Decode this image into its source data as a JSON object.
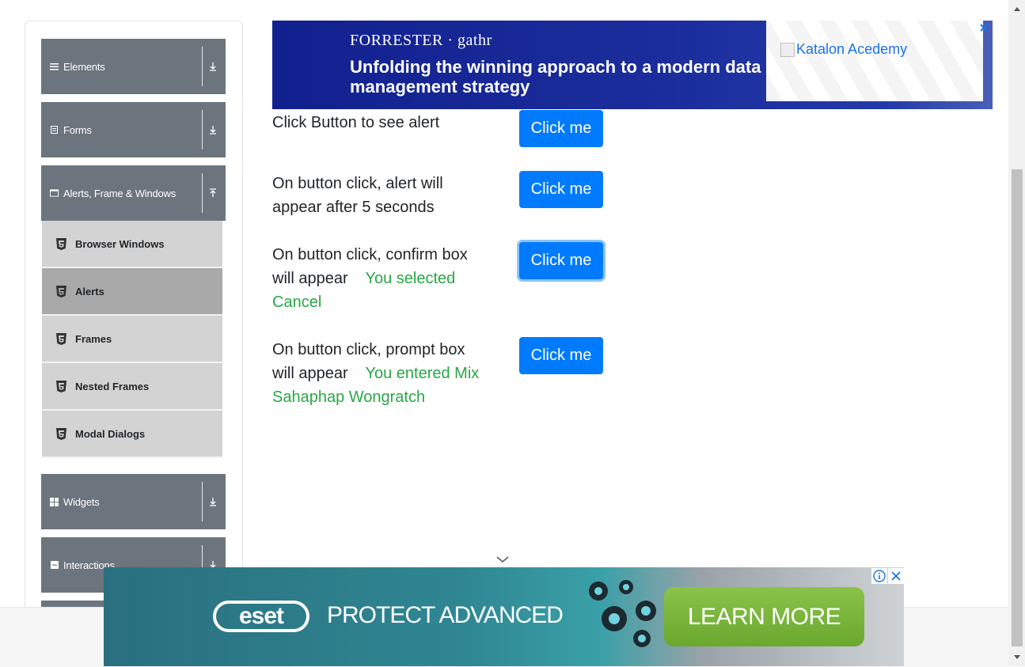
{
  "sidebar": {
    "groups": [
      {
        "label": "Elements",
        "icon": "hamburger-icon",
        "arrow": "chevron-down-icon"
      },
      {
        "label": "Forms",
        "icon": "form-icon",
        "arrow": "chevron-down-icon"
      },
      {
        "label": "Alerts, Frame & Windows",
        "icon": "window-icon",
        "arrow": "chevron-up-icon"
      },
      {
        "label": "Widgets",
        "icon": "widgets-icon",
        "arrow": "chevron-down-icon"
      },
      {
        "label": "Interactions",
        "icon": "interactions-icon",
        "arrow": "chevron-down-icon"
      }
    ],
    "items": [
      {
        "label": "Browser Windows",
        "active": false
      },
      {
        "label": "Alerts",
        "active": true
      },
      {
        "label": "Frames",
        "active": false
      },
      {
        "label": "Nested Frames",
        "active": false
      },
      {
        "label": "Modal Dialogs",
        "active": false
      }
    ]
  },
  "top_ad": {
    "brand": "FORRESTER · gathr",
    "headline": "Unfolding the winning approach to a modern data management strategy"
  },
  "katalon_ad": {
    "alt_text": "Katalon Acedemy"
  },
  "alerts": [
    {
      "text": "Click Button to see alert",
      "result": "",
      "button": "Click me"
    },
    {
      "text": "On button click, alert will appear after 5 seconds",
      "result": "",
      "button": "Click me"
    },
    {
      "text": "On button click, confirm box will appear",
      "result": "You selected Cancel",
      "button": "Click me"
    },
    {
      "text": "On button click, prompt box will appear",
      "result": "You entered Mix Sahaphap Wongratch",
      "button": "Click me"
    }
  ],
  "bottom_ad": {
    "logo": "eset",
    "tagline": "PROTECT ADVANCED",
    "cta": "LEARN MORE"
  },
  "colors": {
    "sidebar_header": "#6c757d",
    "menu_item": "#d3d3d3",
    "menu_item_active": "#a9a9a9",
    "primary_button": "#007bff",
    "result_text": "#28a745"
  }
}
